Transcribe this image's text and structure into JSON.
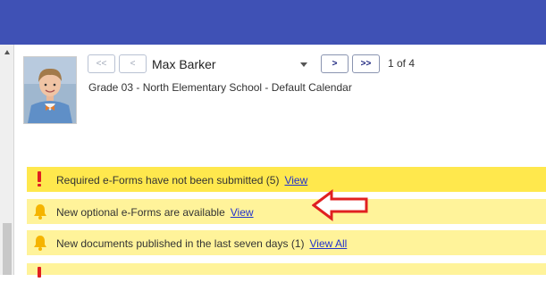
{
  "student": {
    "name": "Max Barker",
    "grade_line": "Grade 03 - North Elementary School - Default Calendar",
    "page_count": "1 of 4"
  },
  "nav": {
    "first": "<<",
    "prev": "<",
    "next": ">",
    "last": ">>"
  },
  "alerts": {
    "required": {
      "text": "Required e-Forms have not been submitted (5)",
      "link": "View"
    },
    "optional": {
      "text": "New optional e-Forms are available",
      "link": "View"
    },
    "documents": {
      "text": "New documents published in the last seven days (1)",
      "link": "View All"
    }
  },
  "colors": {
    "header": "#3f51b5",
    "alert_required_bg": "#ffe84d",
    "alert_bg": "#fff39a",
    "link": "#2233cc",
    "warning": "#e02020",
    "bell": "#f5b400",
    "arrow": "#e02020"
  },
  "icons": [
    "exclamation-icon",
    "bell-icon",
    "bell-icon",
    "red-arrow-icon"
  ]
}
